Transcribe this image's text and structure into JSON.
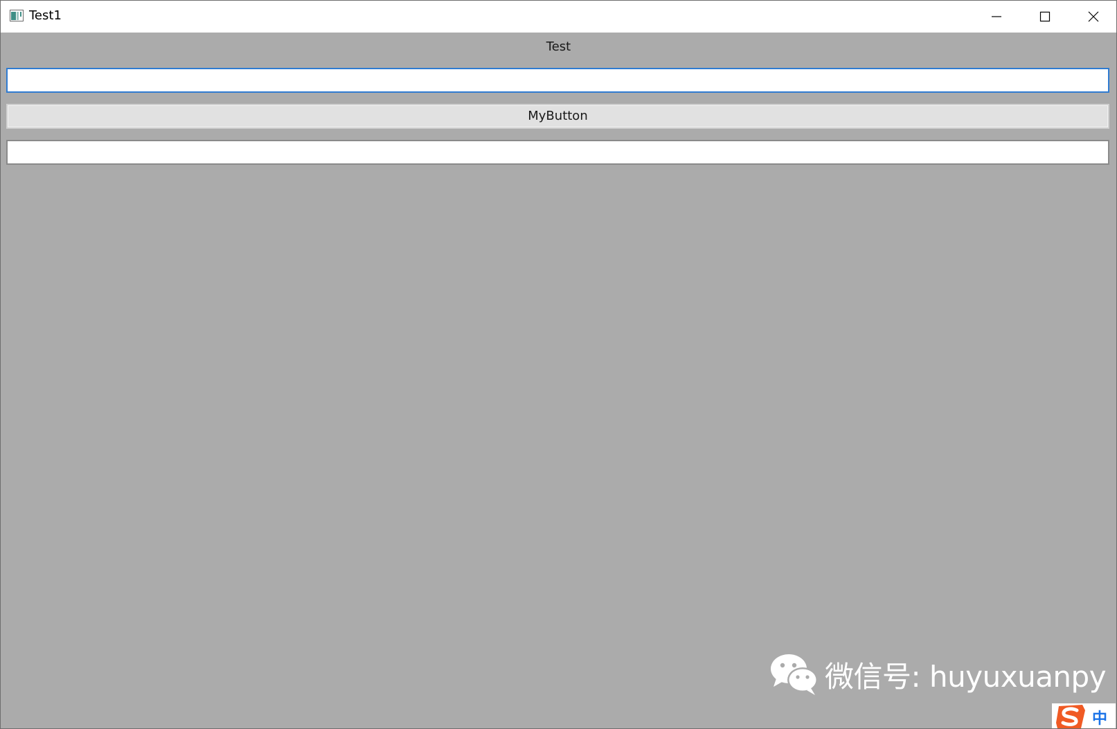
{
  "window": {
    "title": "Test1",
    "controls": {
      "minimize": "minimize-icon",
      "maximize": "maximize-icon",
      "close": "close-icon"
    }
  },
  "main": {
    "heading": "Test",
    "input_top": {
      "value": "",
      "placeholder": ""
    },
    "button_label": "MyButton",
    "input_bottom": {
      "value": "",
      "placeholder": ""
    }
  },
  "watermark": {
    "text": "微信号: huyuxuanpy",
    "icon": "wechat-icon"
  },
  "ime": {
    "indicator": "中",
    "icon": "sogou-icon"
  },
  "colors": {
    "background": "#ababab",
    "titlebar": "#ffffff",
    "focus_border": "#2f7bd1",
    "button_face": "#e1e1e1",
    "ime_accent": "#1a73e8"
  }
}
